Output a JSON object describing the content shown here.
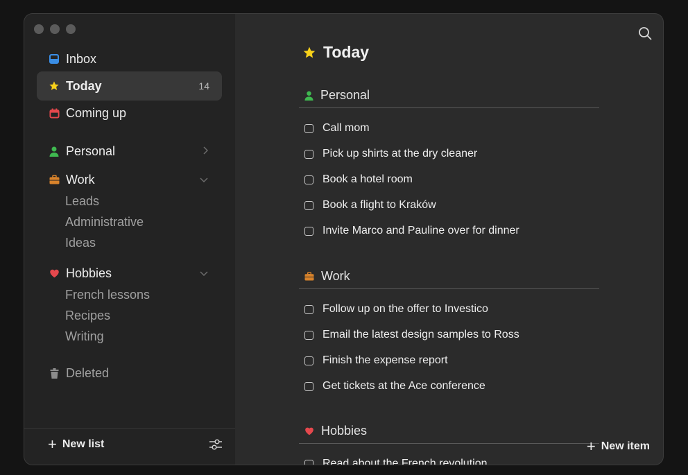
{
  "sidebar": {
    "inbox": {
      "label": "Inbox",
      "icon": "inbox-icon"
    },
    "today": {
      "label": "Today",
      "count": "14",
      "icon": "star-icon"
    },
    "coming_up": {
      "label": "Coming up",
      "icon": "calendar-icon"
    },
    "personal": {
      "label": "Personal",
      "icon": "person-icon"
    },
    "work": {
      "label": "Work",
      "icon": "briefcase-icon",
      "children": [
        "Leads",
        "Administrative",
        "Ideas"
      ]
    },
    "hobbies": {
      "label": "Hobbies",
      "icon": "heart-icon",
      "children": [
        "French lessons",
        "Recipes",
        "Writing"
      ]
    },
    "deleted": {
      "label": "Deleted",
      "icon": "trash-icon"
    },
    "new_list": "New list"
  },
  "main": {
    "title": "Today",
    "sections": [
      {
        "name": "Personal",
        "icon": "person-icon",
        "tasks": [
          "Call mom",
          "Pick up shirts at the dry cleaner",
          "Book a hotel room",
          "Book a flight to Kraków",
          "Invite Marco and Pauline over for dinner"
        ]
      },
      {
        "name": "Work",
        "icon": "briefcase-icon",
        "tasks": [
          "Follow up on the offer to Investico",
          "Email the latest design samples to Ross",
          "Finish the expense report",
          "Get tickets at the Ace conference"
        ]
      },
      {
        "name": "Hobbies",
        "icon": "heart-icon",
        "tasks": [
          "Read about the French revolution"
        ]
      }
    ],
    "new_item": "New item"
  },
  "colors": {
    "star": "#f7d11a",
    "inbox": "#3a8ee6",
    "calendar": "#e5484d",
    "person": "#3fb950",
    "briefcase": "#d9832b",
    "heart": "#e5484d"
  }
}
